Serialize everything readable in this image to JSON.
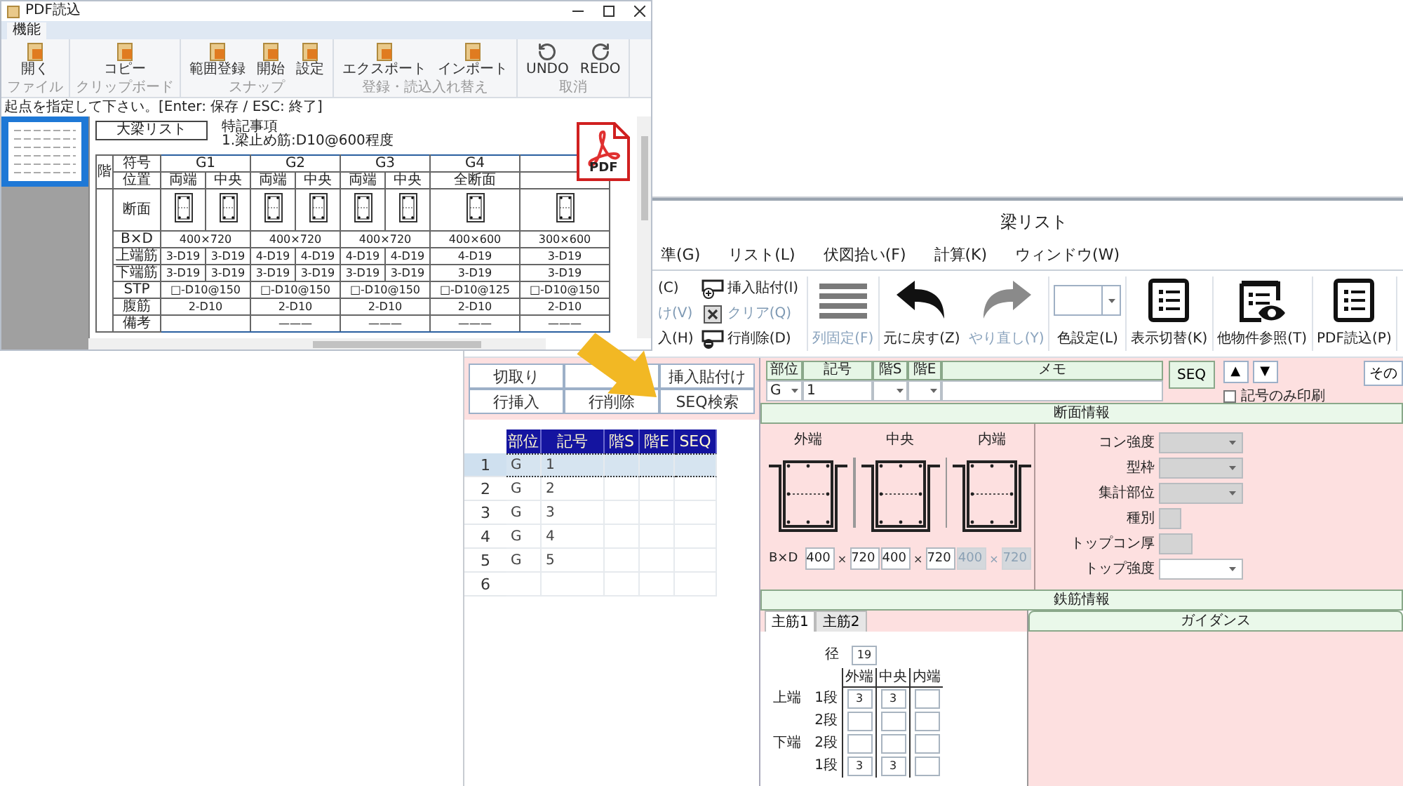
{
  "pdf_window": {
    "title": "PDF読込",
    "ribbon_tab": "機能",
    "groups": [
      {
        "label": "ファイル",
        "tools": [
          {
            "label": "開く",
            "kind": "file"
          }
        ]
      },
      {
        "label": "クリップボード",
        "tools": [
          {
            "label": "コピー",
            "kind": "file"
          }
        ]
      },
      {
        "label": "スナップ",
        "tools": [
          {
            "label": "範囲登録",
            "kind": "file"
          },
          {
            "label": "開始",
            "kind": "file"
          },
          {
            "label": "設定",
            "kind": "file"
          }
        ]
      },
      {
        "label": "登録・読込入れ替え",
        "tools": [
          {
            "label": "エクスポート",
            "kind": "file"
          },
          {
            "label": "インポート",
            "kind": "file"
          }
        ]
      },
      {
        "label": "取消",
        "tools": [
          {
            "label": "UNDO",
            "kind": "undo"
          },
          {
            "label": "REDO",
            "kind": "redo"
          }
        ]
      }
    ],
    "status": "起点を指定して下さい。[Enter: 保存 / ESC: 終了]",
    "document": {
      "title": "大梁リスト",
      "notes": [
        "特記事項",
        "1.梁止め筋:D10@600程度"
      ],
      "floor_header": "階",
      "row_labels": [
        "符号",
        "位置",
        "断面",
        "B×D",
        "上端筋",
        "下端筋",
        "STP",
        "腹筋",
        "備考"
      ],
      "beams": [
        {
          "mark": "G1",
          "positions": [
            "両端",
            "中央"
          ],
          "size": "400×720",
          "top": [
            "3-D19",
            "3-D19"
          ],
          "bottom": [
            "3-D19",
            "3-D19"
          ],
          "stirrup": "□-D10@150",
          "web": "2-D10"
        },
        {
          "mark": "G2",
          "positions": [
            "両端",
            "中央"
          ],
          "size": "400×720",
          "top": [
            "4-D19",
            "4-D19"
          ],
          "bottom": [
            "3-D19",
            "3-D19"
          ],
          "stirrup": "□-D10@150",
          "web": "2-D10",
          "remark": "———"
        },
        {
          "mark": "G3",
          "positions": [
            "両端",
            "中央"
          ],
          "size": "400×720",
          "top": [
            "4-D19",
            "4-D19"
          ],
          "bottom": [
            "3-D19",
            "3-D19"
          ],
          "stirrup": "□-D10@150",
          "web": "2-D10",
          "remark": "———"
        },
        {
          "mark": "G4",
          "positions": [
            "全断面"
          ],
          "size": "400×600",
          "top": [
            "4-D19"
          ],
          "bottom": [
            "3-D19"
          ],
          "stirrup": "□-D10@125",
          "web": "2-D10",
          "remark": "———"
        },
        {
          "size": "300×600",
          "top": [
            "3-D19"
          ],
          "bottom": [
            "3-D19"
          ],
          "stirrup": "□-D10@150",
          "web": "2-D10",
          "remark": "———"
        }
      ]
    }
  },
  "app": {
    "title": "梁リスト",
    "menu": [
      "準(G)",
      "リスト(L)",
      "伏図拾い(F)",
      "計算(K)",
      "ウィンドウ(W)"
    ],
    "edit_tools": [
      {
        "label": "(C)",
        "disabled": false
      },
      {
        "label": "け(V)",
        "disabled": true
      },
      {
        "label": "入(H)",
        "disabled": false
      }
    ],
    "row_tools": [
      {
        "label": "挿入貼付(I)",
        "kind": "insert",
        "disabled": false
      },
      {
        "label": "クリア(Q)",
        "kind": "clear",
        "disabled": true
      },
      {
        "label": "行削除(D)",
        "kind": "delete",
        "disabled": false
      }
    ],
    "toolbar": [
      {
        "label": "列固定(F)",
        "kind": "lines",
        "disabled": true
      },
      {
        "label": "元に戻す(Z)",
        "kind": "undo",
        "disabled": false
      },
      {
        "label": "やり直し(Y)",
        "kind": "redo",
        "disabled": true
      },
      {
        "label": "色設定(L)",
        "kind": "color",
        "disabled": false
      },
      {
        "label": "表示切替(K)",
        "kind": "list",
        "disabled": false
      },
      {
        "label": "他物件参照(T)",
        "kind": "list-eye",
        "disabled": false
      },
      {
        "label": "PDF読込(P)",
        "kind": "list",
        "disabled": false
      }
    ],
    "row_buttons": [
      {
        "label": "切取り"
      },
      {
        "label": "挿入貼付け"
      },
      {
        "label": "行挿入"
      },
      {
        "label": "行削除"
      },
      {
        "label": "SEQ検索"
      }
    ],
    "grid": {
      "columns": [
        "部位",
        "記号",
        "階S",
        "階E",
        "SEQ"
      ],
      "rows": [
        {
          "number": "1",
          "cells": [
            "G",
            "1"
          ],
          "selected": true
        },
        {
          "number": "2",
          "cells": [
            "G",
            "2"
          ],
          "selected": false
        },
        {
          "number": "3",
          "cells": [
            "G",
            "3"
          ],
          "selected": false
        },
        {
          "number": "4",
          "cells": [
            "G",
            "4"
          ],
          "selected": false
        },
        {
          "number": "5",
          "cells": [
            "G",
            "5"
          ],
          "selected": false
        },
        {
          "number": "6",
          "cells": [],
          "selected": false
        }
      ]
    },
    "record": {
      "fields": [
        {
          "label": "部位",
          "value": "G",
          "kind": "select"
        },
        {
          "label": "記号",
          "value": "1",
          "kind": "text"
        },
        {
          "label": "階S",
          "kind": "select"
        },
        {
          "label": "階E",
          "kind": "select"
        },
        {
          "label": "メモ",
          "kind": "text"
        }
      ],
      "seq_label": "SEQ",
      "up": "▲",
      "down": "▼",
      "print_only_mark": {
        "label": "記号のみ印刷",
        "checked": false
      },
      "other_button": "その"
    },
    "section": {
      "title": "断面情報",
      "positions": [
        "外端",
        "中央",
        "内端"
      ],
      "bxd_label": "B×D",
      "sizes": [
        {
          "b": "400",
          "x": "×",
          "d": "720",
          "disabled": false
        },
        {
          "b": "400",
          "x": "×",
          "d": "720",
          "disabled": false
        },
        {
          "b": "400",
          "x": "×",
          "d": "720",
          "disabled": true
        }
      ],
      "properties": [
        {
          "label": "コン強度",
          "kind": "select",
          "disabled": true
        },
        {
          "label": "型枠",
          "kind": "select",
          "disabled": true
        },
        {
          "label": "集計部位",
          "kind": "select",
          "disabled": true
        },
        {
          "label": "種別",
          "kind": "small",
          "disabled": true
        },
        {
          "label": "トップコン厚",
          "kind": "medium",
          "disabled": true
        },
        {
          "label": "トップ強度",
          "kind": "select",
          "disabled": false
        }
      ]
    },
    "rebar": {
      "title": "鉄筋情報",
      "tabs": [
        {
          "label": "主筋1",
          "selected": true
        },
        {
          "label": "主筋2",
          "selected": false
        }
      ],
      "diameter_label": "径",
      "diameter": "19",
      "columns": [
        "外端",
        "中央",
        "内端"
      ],
      "rows": [
        {
          "group": "上端",
          "label": "1段",
          "values": [
            "3",
            "3"
          ]
        },
        {
          "label": "2段",
          "values": []
        },
        {
          "group": "下端",
          "label": "2段",
          "values": []
        },
        {
          "label": "1段",
          "values": [
            "3",
            "3"
          ]
        }
      ]
    },
    "guidance": {
      "title": "ガイダンス"
    }
  },
  "pdf_badge": {
    "label": "PDF"
  }
}
